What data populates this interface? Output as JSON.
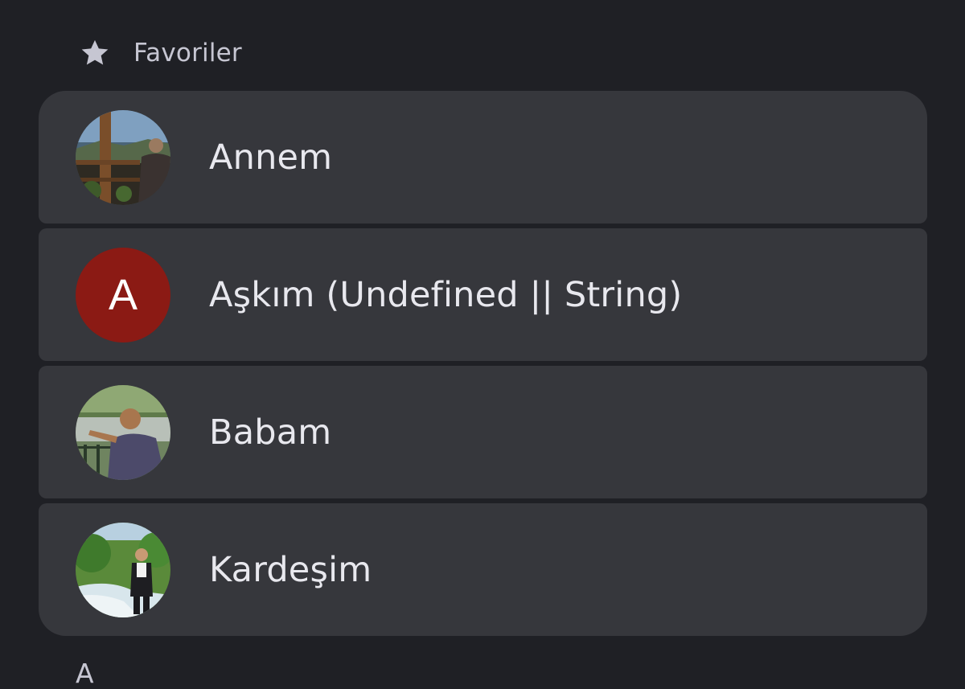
{
  "favorites": {
    "title": "Favoriler",
    "icon": "star-icon"
  },
  "contacts": [
    {
      "name": "Annem",
      "avatar": "photo"
    },
    {
      "name": "Aşkım (Undefined || String)",
      "avatar": "letter",
      "initial": "A",
      "avatar_color": "#8b1a14"
    },
    {
      "name": "Babam",
      "avatar": "photo"
    },
    {
      "name": "Kardeşim",
      "avatar": "photo"
    }
  ],
  "next_section": {
    "letter": "A"
  },
  "colors": {
    "background": "#1f2025",
    "card": "#36373c",
    "text": "#e8e8ee"
  }
}
